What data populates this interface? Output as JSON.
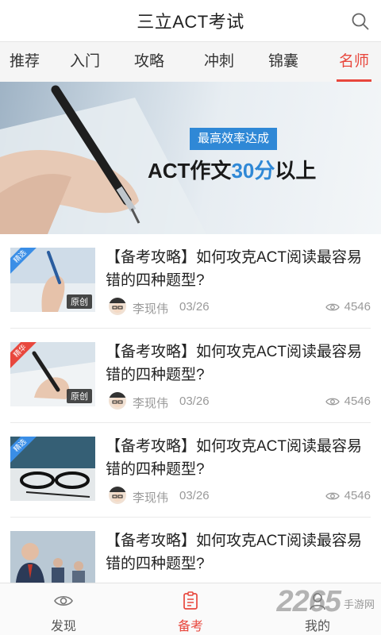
{
  "header": {
    "title": "三立ACT考试"
  },
  "tabs": [
    {
      "label": "推荐",
      "active": false
    },
    {
      "label": "入门",
      "active": false
    },
    {
      "label": "攻略",
      "active": false
    },
    {
      "label": "冲刺",
      "active": false
    },
    {
      "label": "锦囊",
      "active": false
    },
    {
      "label": "名师",
      "active": true
    }
  ],
  "banner": {
    "tag": "最高效率达成",
    "headline_pre": "ACT作文",
    "headline_highlight": "30分",
    "headline_post": "以上"
  },
  "articles": [
    {
      "title": "【备考攻略】如何攻克ACT阅读最容易错的四种题型?",
      "ribbon": "精选",
      "ribbon_color": "#3a8ee6",
      "badge": "原创",
      "author": "李现伟",
      "date": "03/26",
      "views": "4546"
    },
    {
      "title": "【备考攻略】如何攻克ACT阅读最容易错的四种题型?",
      "ribbon": "精华",
      "ribbon_color": "#e8473d",
      "badge": "原创",
      "author": "李现伟",
      "date": "03/26",
      "views": "4546"
    },
    {
      "title": "【备考攻略】如何攻克ACT阅读最容易错的四种题型?",
      "ribbon": "精选",
      "ribbon_color": "#3a8ee6",
      "badge": "",
      "author": "李现伟",
      "date": "03/26",
      "views": "4546"
    },
    {
      "title": "【备考攻略】如何攻克ACT阅读最容易错的四种题型?",
      "ribbon": "",
      "ribbon_color": "",
      "badge": "",
      "author": "",
      "date": "",
      "views": ""
    }
  ],
  "bottom_nav": [
    {
      "label": "发现",
      "icon": "eye-icon",
      "active": false
    },
    {
      "label": "备考",
      "icon": "document-icon",
      "active": true
    },
    {
      "label": "我的",
      "icon": "user-icon",
      "active": false
    }
  ],
  "watermark": {
    "big": "2265",
    "small": "手游网"
  },
  "colors": {
    "accent": "#e8473d",
    "blue": "#2f88d6"
  }
}
